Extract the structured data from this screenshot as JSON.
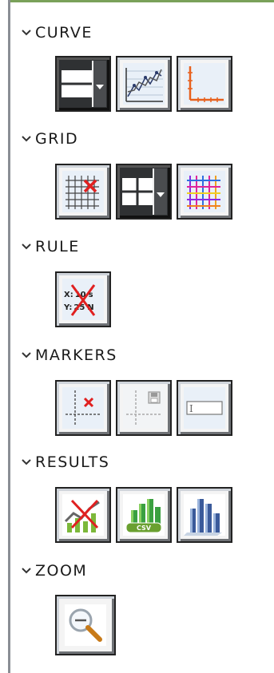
{
  "sections": {
    "curve": {
      "title": "CURVE"
    },
    "grid": {
      "title": "GRID"
    },
    "rule": {
      "title": "RULE"
    },
    "markers": {
      "title": "MARKERS"
    },
    "results": {
      "title": "RESULTS"
    },
    "zoom": {
      "title": "ZOOM"
    }
  },
  "rule_icon": {
    "x_label": "X:",
    "x_value": "10",
    "x_unit": "s",
    "y_label": "Y:",
    "y_value": "25",
    "y_unit": "N"
  },
  "results_icon": {
    "csv_label": "CSV"
  },
  "markers_icon": {
    "cursor_text": "I"
  },
  "colors": {
    "accent_green": "#7aa15a",
    "frame": "#222222",
    "dark_button": "#2f3133"
  }
}
